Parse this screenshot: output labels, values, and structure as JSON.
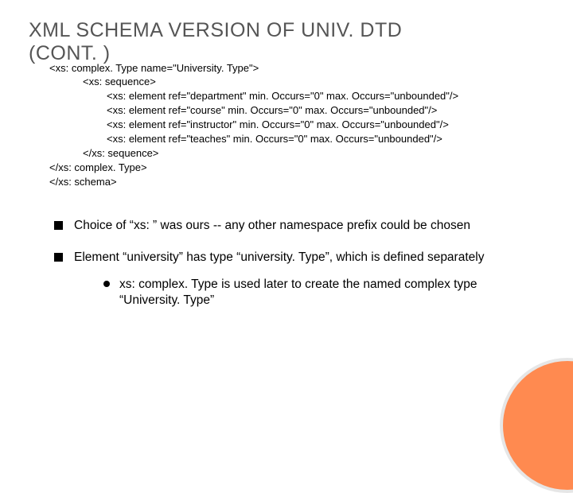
{
  "title_line1": "XML SCHEMA VERSION OF UNIV. DTD",
  "title_line2": "(CONT. )",
  "code": {
    "l0": "<xs: complex. Type name=\"University. Type\">",
    "l1": "<xs: sequence>",
    "l2": "<xs: element ref=\"department\" min. Occurs=\"0\" max. Occurs=\"unbounded\"/>",
    "l3": "<xs: element ref=\"course\" min. Occurs=\"0\" max. Occurs=\"unbounded\"/>",
    "l4": "<xs: element ref=\"instructor\" min. Occurs=\"0\" max. Occurs=\"unbounded\"/>",
    "l5": "<xs: element ref=\"teaches\" min. Occurs=\"0\" max. Occurs=\"unbounded\"/>",
    "l6": "</xs: sequence>",
    "l7": "</xs: complex. Type>",
    "l8": "</xs: schema>"
  },
  "bullets": {
    "b1": "Choice of “xs: ” was ours -- any other namespace prefix could be chosen",
    "b2": "Element “university” has type “university. Type”, which is defined separately",
    "sub": "xs: complex. Type is used later to create the named complex type “University. Type”"
  }
}
